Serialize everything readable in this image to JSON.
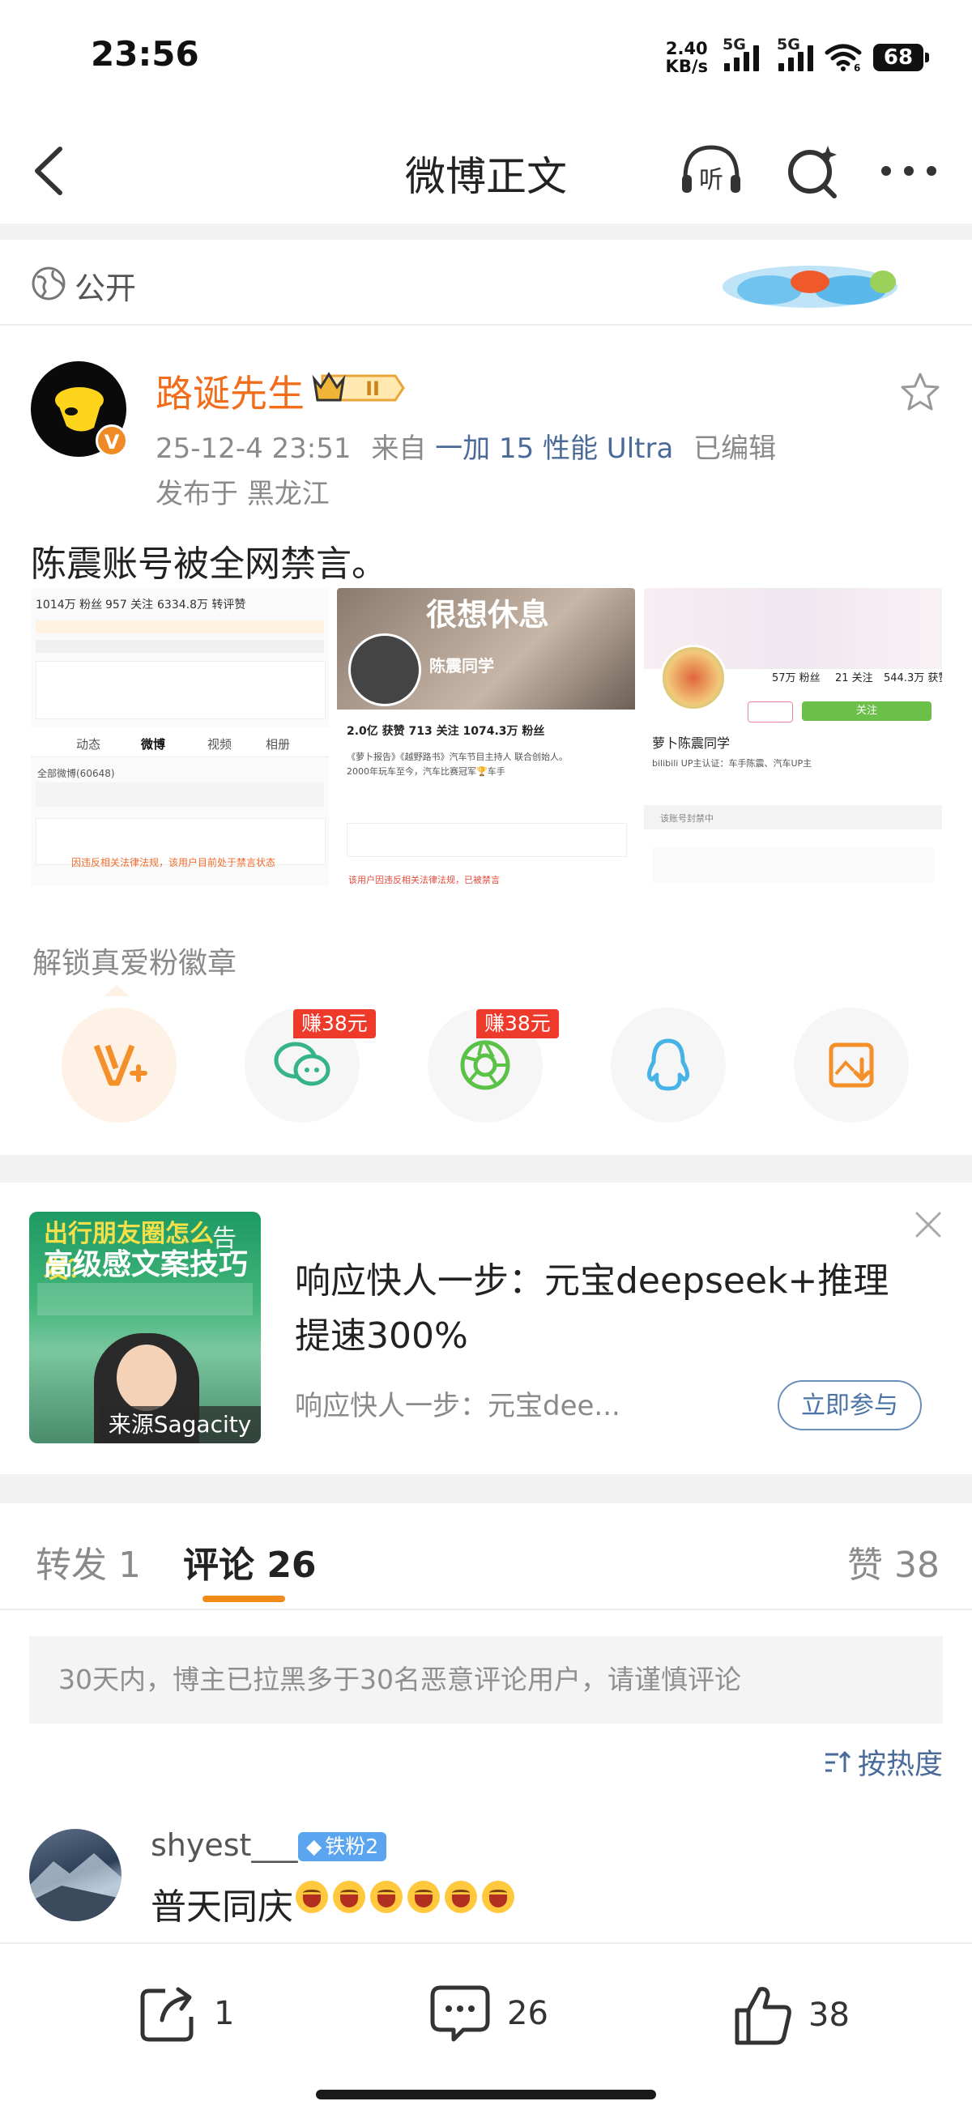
{
  "status": {
    "time": "23:56",
    "net_speed_top": "2.40",
    "net_speed_bottom": "KB/s",
    "signal1_tag": "5G",
    "signal2_tag": "5G",
    "wifi_sub": "6",
    "battery": "68"
  },
  "nav": {
    "title": "微博正文",
    "listen_label": "听"
  },
  "post": {
    "visibility": "公开",
    "author": "路诞先生",
    "member_level": "II",
    "avatar_badge": "V",
    "time": "25-12-4 23:51",
    "from_prefix": "来自",
    "device": "一加 15 性能 Ultra",
    "edited": "已编辑",
    "location": "发布于 黑龙江",
    "text": "陈震账号被全网禁言。"
  },
  "images": {
    "img1": {
      "stats": [
        "1014万 粉丝",
        "957 关注",
        "6334.8万 转评赞"
      ],
      "tabs": [
        "动态",
        "微博",
        "视频",
        "相册"
      ],
      "all_weibo": "全部微博(60648)",
      "notice": "因违反相关法律法规，该用户目前处于禁言状态"
    },
    "img2": {
      "banner": "很想休息",
      "name": "陈震同学",
      "stats": "2.0亿 获赞  713 关注  1074.3万 粉丝",
      "bio1": "《萝卜报告》《越野路书》汽车节目主持人 联合创始人。",
      "bio2": "2000年玩车至今，汽车比赛冠军🏆车手",
      "notice": "该用户因违反相关法律法规，已被禁言"
    },
    "img3": {
      "stats": [
        "57万 粉丝",
        "21 关注",
        "544.3万 获赞"
      ],
      "follow": "关注",
      "name": "萝卜陈震同学",
      "verify": "bilibili UP主认证：车手陈震、汽车UP主",
      "section": "该账号封禁中"
    }
  },
  "unlock": {
    "title": "解锁真爱粉徽章",
    "earn_label_1": "赚38元",
    "earn_label_2": "赚38元"
  },
  "ad": {
    "image_tag": "告",
    "image_headline1": "出行朋友圈怎么发？",
    "image_headline2": "高级感文案技巧",
    "source": "来源Sagacity",
    "title": "响应快人一步：元宝deepseek+推理提速300%",
    "desc": "响应快人一步：元宝dee...",
    "cta": "立即参与"
  },
  "tabs": {
    "repost": "转发 1",
    "comments": "评论 26",
    "likes": "赞 38"
  },
  "notice": "30天内，博主已拉黑多于30名恶意评论用户，请谨慎评论",
  "sort_label": "按热度",
  "comment": {
    "user": "shyest___",
    "badge": "铁粉2",
    "text": "普天同庆"
  },
  "bottom": {
    "repost_count": "1",
    "comment_count": "26",
    "like_count": "38"
  },
  "colors": {
    "brand_orange": "#f26d1b",
    "tab_accent": "#f28a19",
    "link_blue": "#4a6a9a",
    "earn_red": "#ee3a2b"
  }
}
